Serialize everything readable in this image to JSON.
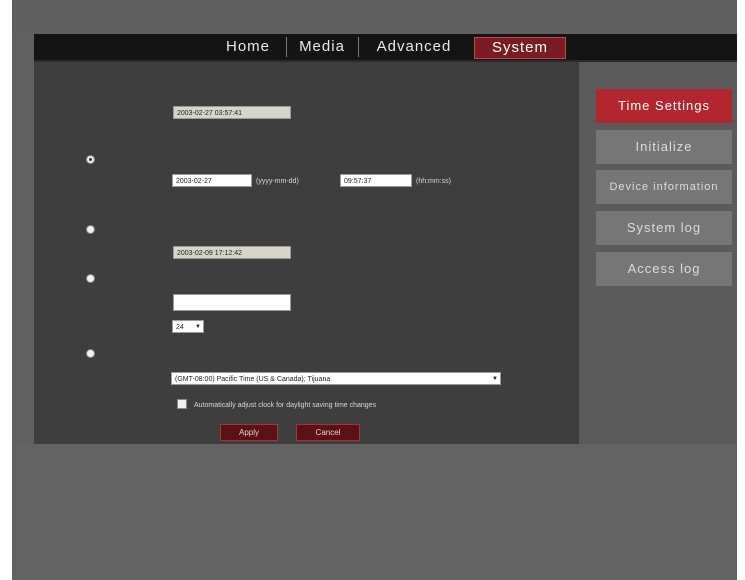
{
  "nav": {
    "items": [
      "Home",
      "Media",
      "Advanced",
      "System"
    ],
    "active": "System"
  },
  "sidebar": {
    "items": [
      "Time Settings",
      "Initialize",
      "Device information",
      "System log",
      "Access log"
    ],
    "active": "Time Settings"
  },
  "form": {
    "current_time_value": "2003-02-27 03:57:41",
    "manual_date": "2003-02-27",
    "date_format": "(yyyy-mm-dd)",
    "manual_time": "09:57:37",
    "time_format": "(hh:mm:ss)",
    "pc_time": "2003-02-09 17:12:42",
    "ntp_server": "",
    "interval": "24",
    "timezone": "(GMT-08:00) Pacific Time (US & Canada); Tijuana",
    "dst_label": "Automatically adjust clock for daylight saving time changes",
    "apply_label": "Apply",
    "cancel_label": "Cancel"
  },
  "colors": {
    "accent_red": "#b3262d",
    "background": "#3e3e3e"
  }
}
